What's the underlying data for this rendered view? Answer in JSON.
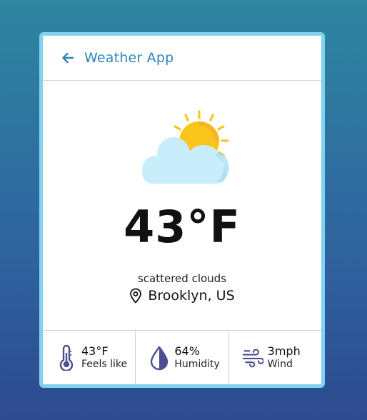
{
  "header": {
    "title": "Weather App"
  },
  "weather": {
    "icon": "partly-cloudy-icon",
    "temperature": "43°F",
    "description": "scattered clouds",
    "location": "Brooklyn, US"
  },
  "stats": [
    {
      "icon": "thermometer-icon",
      "value": "43°F",
      "label": "Feels like"
    },
    {
      "icon": "humidity-drop-icon",
      "value": "64%",
      "label": "Humidity"
    },
    {
      "icon": "wind-icon",
      "value": "3mph",
      "label": "Wind"
    }
  ],
  "colors": {
    "accent": "#2e86b8",
    "card_border": "#7fd3ee",
    "sun": "#f9c51d",
    "cloud": "#c8edfb",
    "stat_icon": "#4b4f8f"
  }
}
